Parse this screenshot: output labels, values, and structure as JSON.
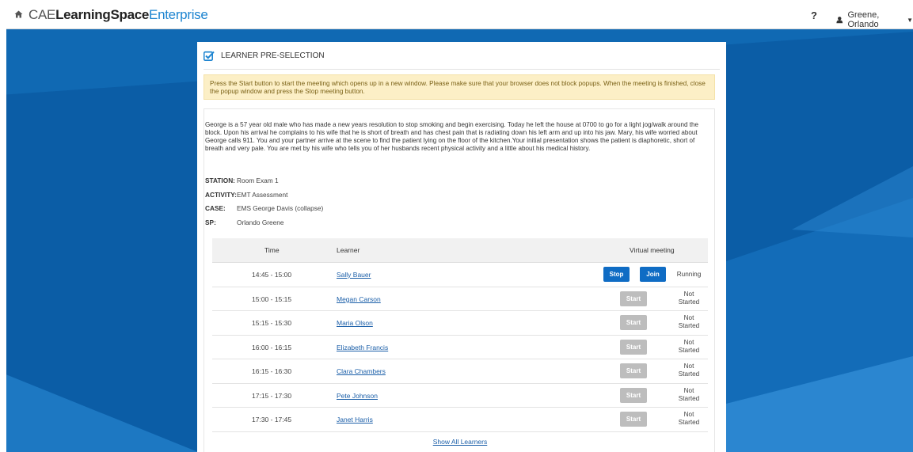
{
  "colors": {
    "background": "#0a5fa8",
    "accent": "#1d84d0",
    "primary_button": "#0f6cc4",
    "disabled_button": "#bdbdbd",
    "alert_bg": "#fcefc6"
  },
  "header": {
    "brand_part1": "CAE",
    "brand_part2": "LearningSpace",
    "brand_part3": "Enterprise",
    "help_label": "?",
    "user_name": "Greene, Orlando",
    "icons": [
      "home-icon",
      "user-icon",
      "caret-down-icon"
    ]
  },
  "card": {
    "title": "LEARNER PRE-SELECTION",
    "alert": "Press the Start button to start the meeting which opens up in a new window. Please make sure that your browser does not block popups. When the meeting is finished, close the popup window and press the Stop meeting button.",
    "description": "George is a 57 year old male who has made a new years resolution to stop smoking and begin exercising. Today he left the house at 0700 to go for a light jog/walk around the block. Upon his arrival he complains to his wife that he is short of breath and has chest pain that is radiating down his left arm and up into his jaw. Mary, his wife worried about George calls 911. You and your partner arrive at the scene to find the patient lying on the floor of the kitchen.Your initial presentation shows the patient is diaphoretic, short of breath and very pale. You are met by his wife who tells you of her husbands recent physical activity and a little about his medical history.",
    "meta": {
      "station_label": "STATION:",
      "station_value": "Room Exam 1",
      "activity_label": "ACTIVITY:",
      "activity_value": "EMT Assessment",
      "case_label": "CASE:",
      "case_value": "EMS George Davis (collapse)",
      "sp_label": "SP:",
      "sp_value": "Orlando Greene"
    },
    "table": {
      "headers": {
        "time": "Time",
        "learner": "Learner",
        "virtual": "Virtual meeting"
      },
      "stop_label": "Stop",
      "join_label": "Join",
      "start_label": "Start",
      "rows": [
        {
          "time": "14:45 - 15:00",
          "learner": "Sally Bauer",
          "status": "Running"
        },
        {
          "time": "15:00 - 15:15",
          "learner": "Megan Carson",
          "status_line1": "Not",
          "status_line2": "Started"
        },
        {
          "time": "15:15 - 15:30",
          "learner": "Maria Olson",
          "status_line1": "Not",
          "status_line2": "Started"
        },
        {
          "time": "16:00 - 16:15",
          "learner": "Elizabeth Francis",
          "status_line1": "Not",
          "status_line2": "Started"
        },
        {
          "time": "16:15 - 16:30",
          "learner": "Clara Chambers",
          "status_line1": "Not",
          "status_line2": "Started"
        },
        {
          "time": "17:15 - 17:30",
          "learner": "Pete Johnson",
          "status_line1": "Not",
          "status_line2": "Started"
        },
        {
          "time": "17:30 - 17:45",
          "learner": "Janet Harris",
          "status_line1": "Not",
          "status_line2": "Started"
        }
      ]
    },
    "show_all": "Show All Learners"
  }
}
